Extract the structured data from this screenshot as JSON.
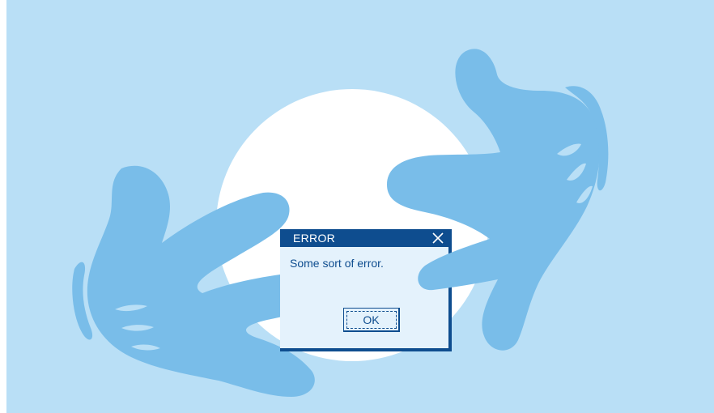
{
  "dialog": {
    "title": "ERROR",
    "message": "Some sort of error.",
    "ok_label": "OK",
    "close_icon": "close-x-icon"
  },
  "colors": {
    "background": "#b9dff6",
    "circle": "#ffffff",
    "hands": "#79bde9",
    "dialog_accent": "#0e4d8f",
    "dialog_body": "#e4f2fc"
  }
}
